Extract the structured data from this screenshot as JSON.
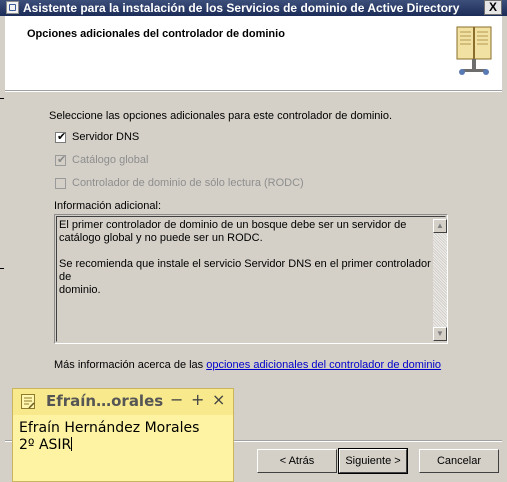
{
  "window": {
    "title": "Asistente para la instalación de los Servicios de dominio de Active Directory",
    "close_label": "X"
  },
  "header": {
    "page_title": "Opciones adicionales del controlador de dominio"
  },
  "body": {
    "instruction": "Seleccione las opciones adicionales para este controlador de dominio.",
    "options": [
      {
        "label": "Servidor DNS",
        "checked": true,
        "enabled": true
      },
      {
        "label": "Catálogo global",
        "checked": true,
        "enabled": false
      },
      {
        "label": "Controlador de dominio de sólo lectura (RODC)",
        "checked": false,
        "enabled": false
      }
    ],
    "info_label": "Información adicional:",
    "info_text": "El primer controlador de dominio de un bosque debe ser un servidor de\ncatálogo global y no puede ser un RODC.\n\nSe recomienda que instale el servicio Servidor DNS en el primer controlador de\ndominio.",
    "more_info_prefix": "Más información acerca de las ",
    "more_info_link": "opciones adicionales del controlador de dominio"
  },
  "buttons": {
    "back": "< Atrás",
    "next": "Siguiente >",
    "cancel": "Cancelar"
  },
  "sticky_note": {
    "title": "Efraín…orales",
    "minimize": "−",
    "add": "+",
    "close": "×",
    "line1": "Efraín Hernández Morales",
    "line2": "2º ASIR"
  }
}
